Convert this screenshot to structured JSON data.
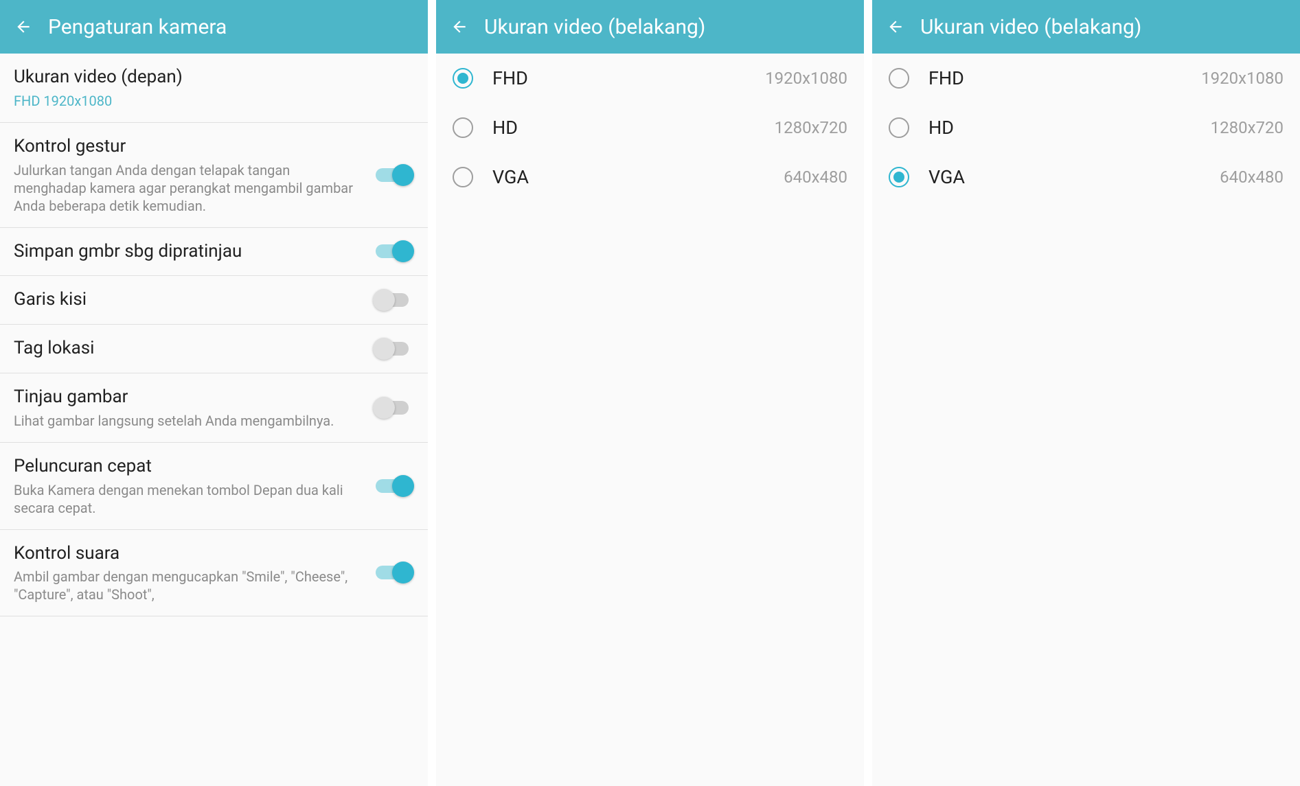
{
  "colors": {
    "accent": "#4db6c8",
    "toggle_on": "#2fb6d0"
  },
  "screens": [
    {
      "header": {
        "title": "Pengaturan kamera"
      },
      "type": "settings",
      "items": [
        {
          "title": "Ukuran video (depan)",
          "subtitle": "FHD 1920x1080",
          "subtitle_accent": true,
          "control": "none"
        },
        {
          "title": "Kontrol gestur",
          "subtitle": "Julurkan tangan Anda dengan telapak tangan menghadap kamera agar perangkat mengambil gambar Anda beberapa detik kemudian.",
          "control": "toggle",
          "on": true
        },
        {
          "title": "Simpan gmbr sbg dipratinjau",
          "control": "toggle",
          "on": true
        },
        {
          "title": "Garis kisi",
          "control": "toggle",
          "on": false
        },
        {
          "title": "Tag lokasi",
          "control": "toggle",
          "on": false
        },
        {
          "title": "Tinjau gambar",
          "subtitle": "Lihat gambar langsung setelah Anda mengambilnya.",
          "control": "toggle",
          "on": false
        },
        {
          "title": "Peluncuran cepat",
          "subtitle": "Buka Kamera dengan menekan tombol Depan dua kali secara cepat.",
          "control": "toggle",
          "on": true
        },
        {
          "title": "Kontrol suara",
          "subtitle": "Ambil gambar dengan mengucapkan \"Smile\", \"Cheese\", \"Capture\", atau \"Shoot\",",
          "control": "toggle",
          "on": true
        }
      ]
    },
    {
      "header": {
        "title": "Ukuran video (belakang)"
      },
      "type": "radio",
      "selected_index": 0,
      "options": [
        {
          "label": "FHD",
          "value": "1920x1080"
        },
        {
          "label": "HD",
          "value": "1280x720"
        },
        {
          "label": "VGA",
          "value": "640x480"
        }
      ]
    },
    {
      "header": {
        "title": "Ukuran video (belakang)"
      },
      "type": "radio",
      "selected_index": 2,
      "options": [
        {
          "label": "FHD",
          "value": "1920x1080"
        },
        {
          "label": "HD",
          "value": "1280x720"
        },
        {
          "label": "VGA",
          "value": "640x480"
        }
      ]
    }
  ]
}
